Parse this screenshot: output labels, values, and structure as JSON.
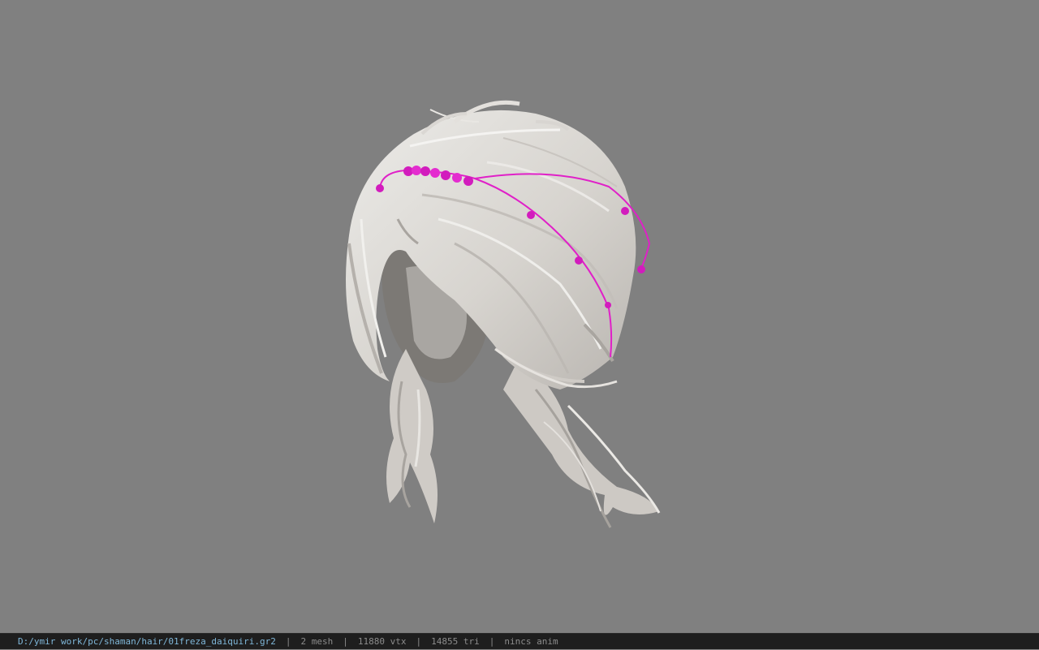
{
  "viewport": {
    "background_color": "#808080",
    "model": {
      "description_icon": "hair-mesh-icon",
      "hair_color": "#dcd9d4",
      "accessory_color": "#e020c8"
    }
  },
  "status_bar": {
    "file_path": "D:/ymir work/pc/shaman/hair/01freza_daiquiri.gr2",
    "separator": "|",
    "mesh": "2 mesh",
    "vertices": "11880 vtx",
    "triangles": "14855 tri",
    "anim": "nincs anim"
  }
}
